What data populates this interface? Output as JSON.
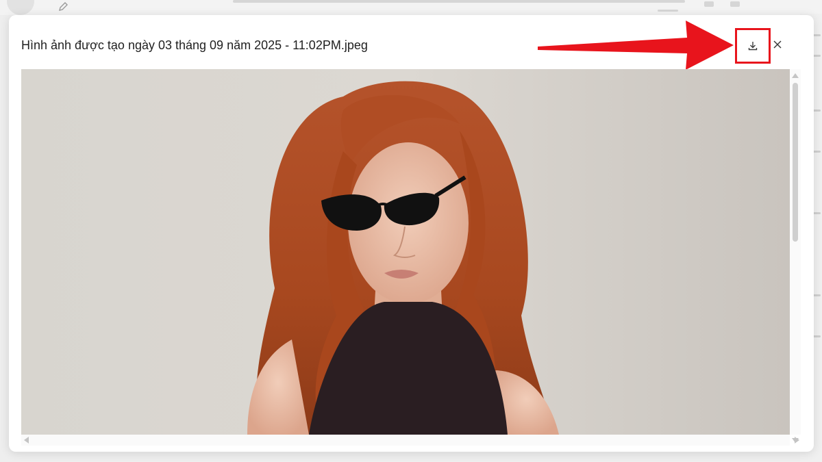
{
  "dialog": {
    "filename": "Hình ảnh được tạo ngày 03 tháng 09 năm 2025 - 11:02PM.jpeg",
    "download_icon": "download-icon",
    "close_icon": "close-icon"
  },
  "annotation": {
    "arrow_color": "#e8141c",
    "highlight_color": "#e8141c"
  },
  "image": {
    "subject_icon": "photo-portrait",
    "background_color": "#d9d6d0",
    "hair_color": "#b4532a",
    "top_color": "#2a1e22"
  }
}
